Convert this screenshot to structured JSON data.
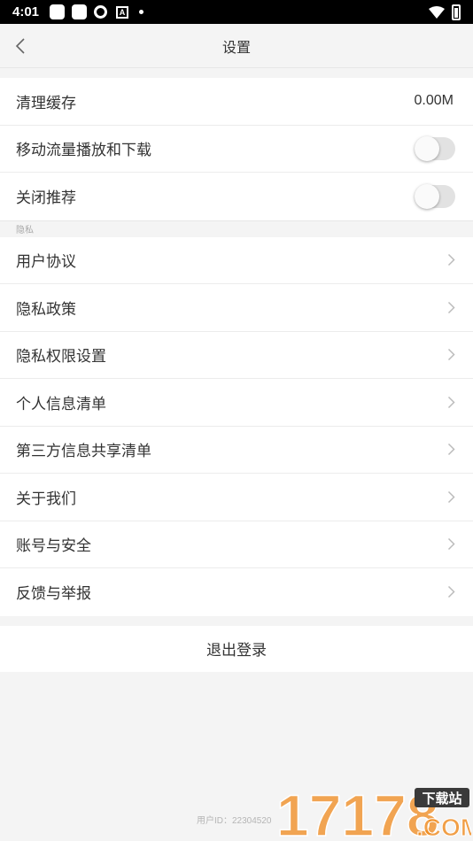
{
  "status_bar": {
    "time": "4:01"
  },
  "header": {
    "title": "设置"
  },
  "settings": {
    "clear_cache": {
      "label": "清理缓存",
      "value": "0.00M"
    },
    "mobile_data": {
      "label": "移动流量播放和下载",
      "enabled": false
    },
    "close_recommend": {
      "label": "关闭推荐",
      "enabled": false
    }
  },
  "privacy": {
    "header": "隐私",
    "items": [
      {
        "label": "用户协议"
      },
      {
        "label": "隐私政策"
      },
      {
        "label": "隐私权限设置"
      },
      {
        "label": "个人信息清单"
      },
      {
        "label": "第三方信息共享清单"
      },
      {
        "label": "关于我们"
      },
      {
        "label": "账号与安全"
      },
      {
        "label": "反馈与举报"
      }
    ]
  },
  "logout": {
    "label": "退出登录"
  },
  "footer": {
    "user_id": "用户ID：22304520"
  },
  "watermark": {
    "number": "17178",
    "tag": "下载站",
    "domain": ".COM"
  },
  "colors": {
    "background": "#f4f4f4",
    "watermark_orange": "#f08a1c"
  }
}
